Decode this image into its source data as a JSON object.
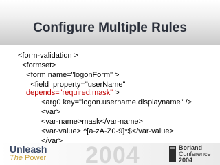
{
  "slide": {
    "title": "Configure Multiple Rules",
    "code_lines": [
      "<form-validation >",
      "  <formset>",
      "    <form name=\"logonForm\" >",
      "      <field  property=\"userName\"",
      "depends=\"required,mask\"",
      " >",
      "<arg0 key=\"logon.username.displayname\" />",
      "<var>",
      "<var-name>mask</var-name>",
      "<var-value> ^[a-zA-Z0-9]*$</var-value>",
      "</var>",
      "…"
    ]
  },
  "footer": {
    "brand_line1": "Unleash",
    "brand_line2_the": "The",
    "brand_line2_power": "Power",
    "watermark_year": "2004",
    "conf_brand": "Borland",
    "conf_label": "Conference",
    "conf_year": "2004"
  },
  "colors": {
    "title": "#2a2f3a",
    "highlight": "#c00000",
    "brand_blue": "#3c4a66",
    "brand_gold": "#c9a23a"
  }
}
